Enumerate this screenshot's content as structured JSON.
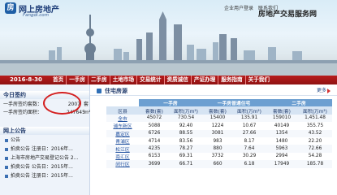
{
  "header": {
    "logo_mark": "房",
    "logo_text": "网上房地产",
    "logo_sub": "Fangdi.com",
    "top_links": [
      "企业用户登录",
      "联系我们"
    ],
    "site_title": "房地产交易服务网"
  },
  "navbar": {
    "date": "2016-8-30",
    "items": [
      "首页",
      "一手房",
      "二手房",
      "土地市场",
      "交易统计",
      "资质诚信",
      "产证办理",
      "服务指南",
      "关于我们"
    ]
  },
  "today": {
    "title": "今日签约",
    "rows": [
      {
        "label": "一手房签约套数：",
        "value": "2007",
        "unit": "套"
      },
      {
        "label": "一手房签约面积：",
        "value": "247645",
        "unit": "m²"
      }
    ]
  },
  "notices": {
    "title": "网上公告",
    "items": [
      "公告",
      "拍卖公告 注册日：2016年...",
      "上海市房地产交易登记公告 2...",
      "拍卖公告 公告日：2015年...",
      "拍卖公告 注册日：2015年..."
    ]
  },
  "main": {
    "title": "住宅房源",
    "more": "更多",
    "groups": [
      "一手房",
      "一手房普通住宅",
      "二手房"
    ],
    "subheaders": [
      "区县",
      "套数(套)",
      "面积(万m²)",
      "套数(套)",
      "面积(万m²)",
      "套数(套)",
      "面积(万m²)"
    ],
    "rows": [
      [
        "全市",
        "45072",
        "730.54",
        "15400",
        "135.91",
        "159010",
        "1,451.48"
      ],
      [
        "浦东新区",
        "5088",
        "92.40",
        "1224",
        "10.67",
        "40149",
        "355.75"
      ],
      [
        "嘉定区",
        "6726",
        "88.55",
        "3081",
        "27.66",
        "1354",
        "43.52"
      ],
      [
        "青浦区",
        "4714",
        "83.56",
        "983",
        "8.17",
        "1480",
        "22.20"
      ],
      [
        "松江区",
        "4235",
        "78.27",
        "880",
        "7.64",
        "5963",
        "72.66"
      ],
      [
        "南汇区",
        "6153",
        "69.31",
        "3732",
        "30.29",
        "2994",
        "54.28"
      ],
      [
        "闵行区",
        "3699",
        "66.71",
        "660",
        "6.18",
        "17949",
        "185.78"
      ]
    ]
  }
}
